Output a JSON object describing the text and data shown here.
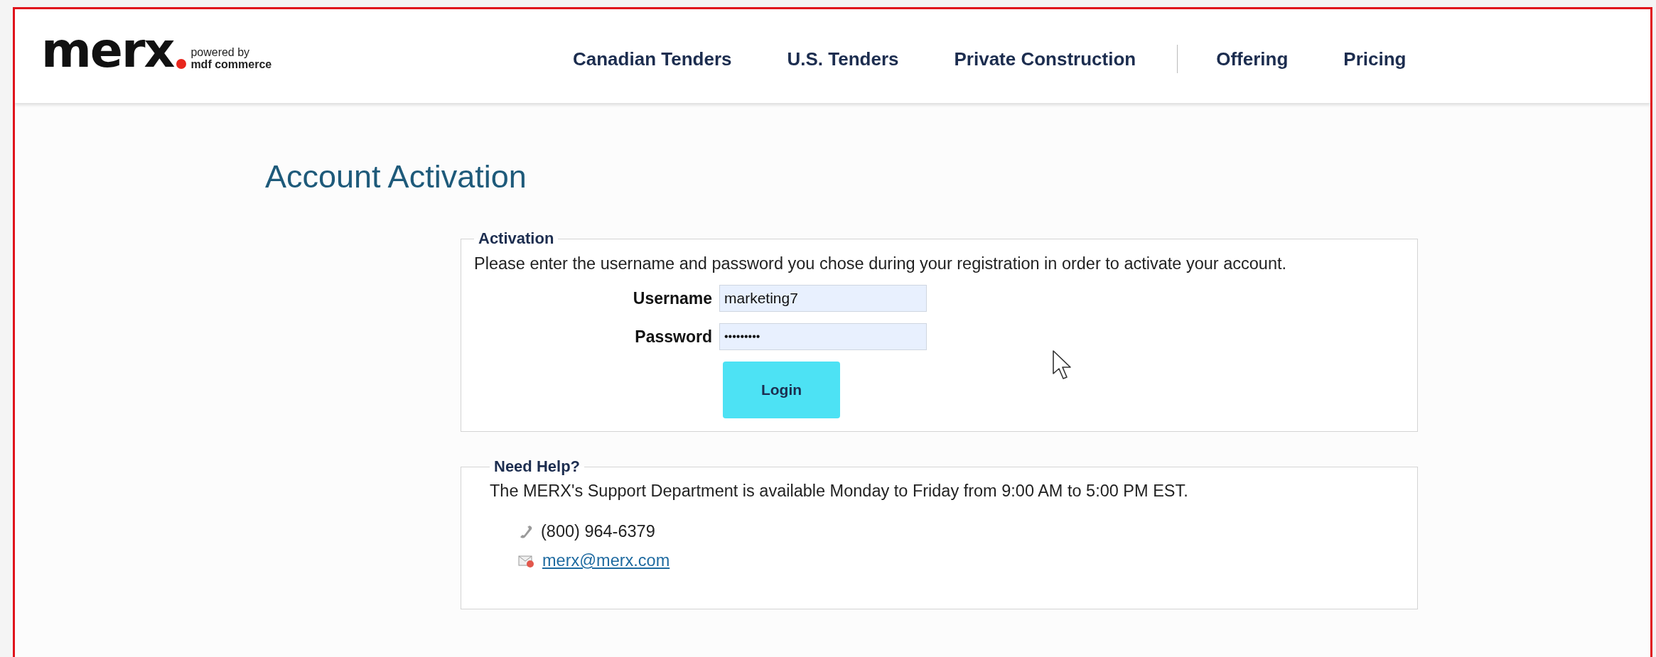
{
  "logo": {
    "brand": "merx",
    "tagline_top": "powered by",
    "tagline_bottom": "mdf commerce"
  },
  "nav": {
    "main": [
      "Canadian Tenders",
      "U.S. Tenders",
      "Private Construction"
    ],
    "secondary": [
      "Offering",
      "Pricing"
    ]
  },
  "page_title": "Account Activation",
  "activation": {
    "legend": "Activation",
    "instructions": "Please enter the username and password you chose during your registration in order to activate your account.",
    "fields": [
      {
        "label": "Username",
        "value": "marketing7",
        "kind": "text"
      },
      {
        "label": "Password",
        "value": "•••••••••",
        "kind": "password"
      }
    ],
    "button": "Login"
  },
  "help": {
    "legend": "Need Help?",
    "text": "The MERX's Support Department is available Monday to Friday from 9:00 AM to 5:00 PM EST.",
    "contacts": [
      {
        "kind": "phone",
        "text": "(800) 964-6379"
      },
      {
        "kind": "email",
        "text": "merx@merx.com"
      }
    ]
  }
}
